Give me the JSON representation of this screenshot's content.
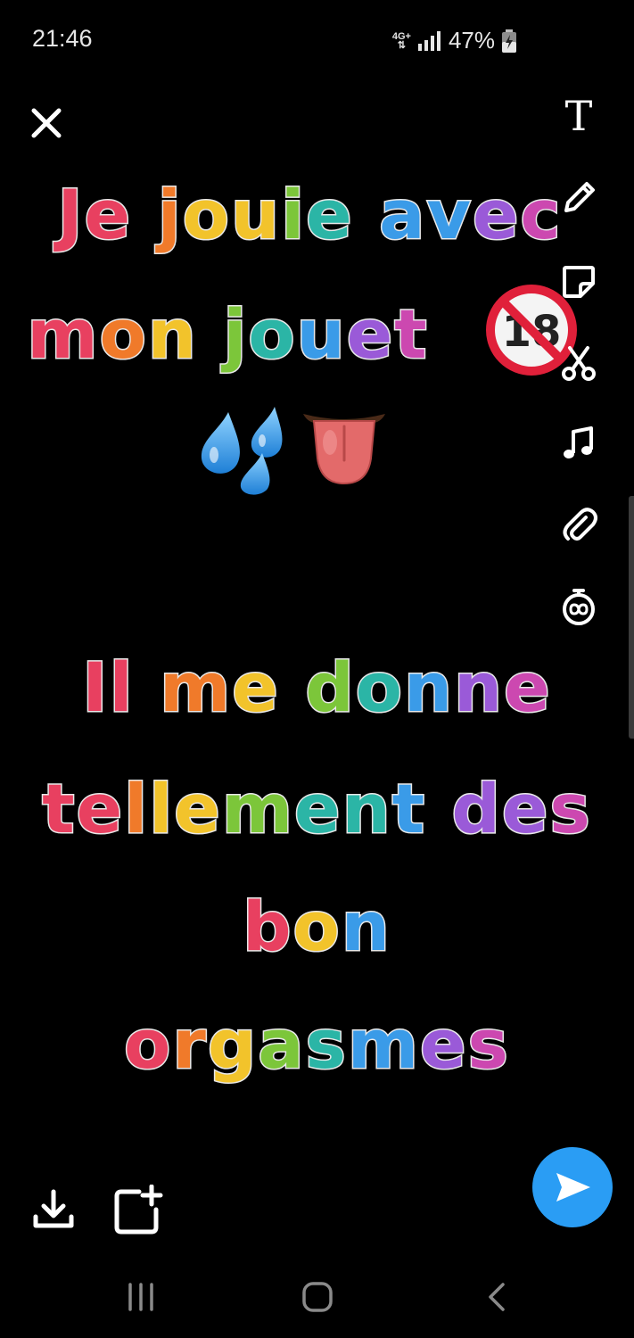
{
  "status_bar": {
    "time": "21:46",
    "network": "4G+",
    "battery": "47%"
  },
  "toolbar": {
    "text_tool_label": "T",
    "icons": [
      "text-icon",
      "pencil-icon",
      "sticker-icon",
      "scissors-icon",
      "music-icon",
      "paperclip-icon",
      "timer-icon"
    ]
  },
  "caption": {
    "line1": "Je jouie avec",
    "line2": "mon jouet",
    "line3": "Il me donne",
    "line4": "tellement des",
    "line5": "bon",
    "line6": "orgasmes",
    "emoji": [
      "no-one-under-eighteen",
      "sweat-droplets",
      "tongue"
    ],
    "age_badge": "18"
  },
  "colors": {
    "accent_send": "#2a9df4",
    "rainbow": [
      "#e84060",
      "#f07a2a",
      "#f2c32b",
      "#7cc63a",
      "#2bb5a6",
      "#3a9be8",
      "#9a5ad8",
      "#cc48b0"
    ]
  }
}
